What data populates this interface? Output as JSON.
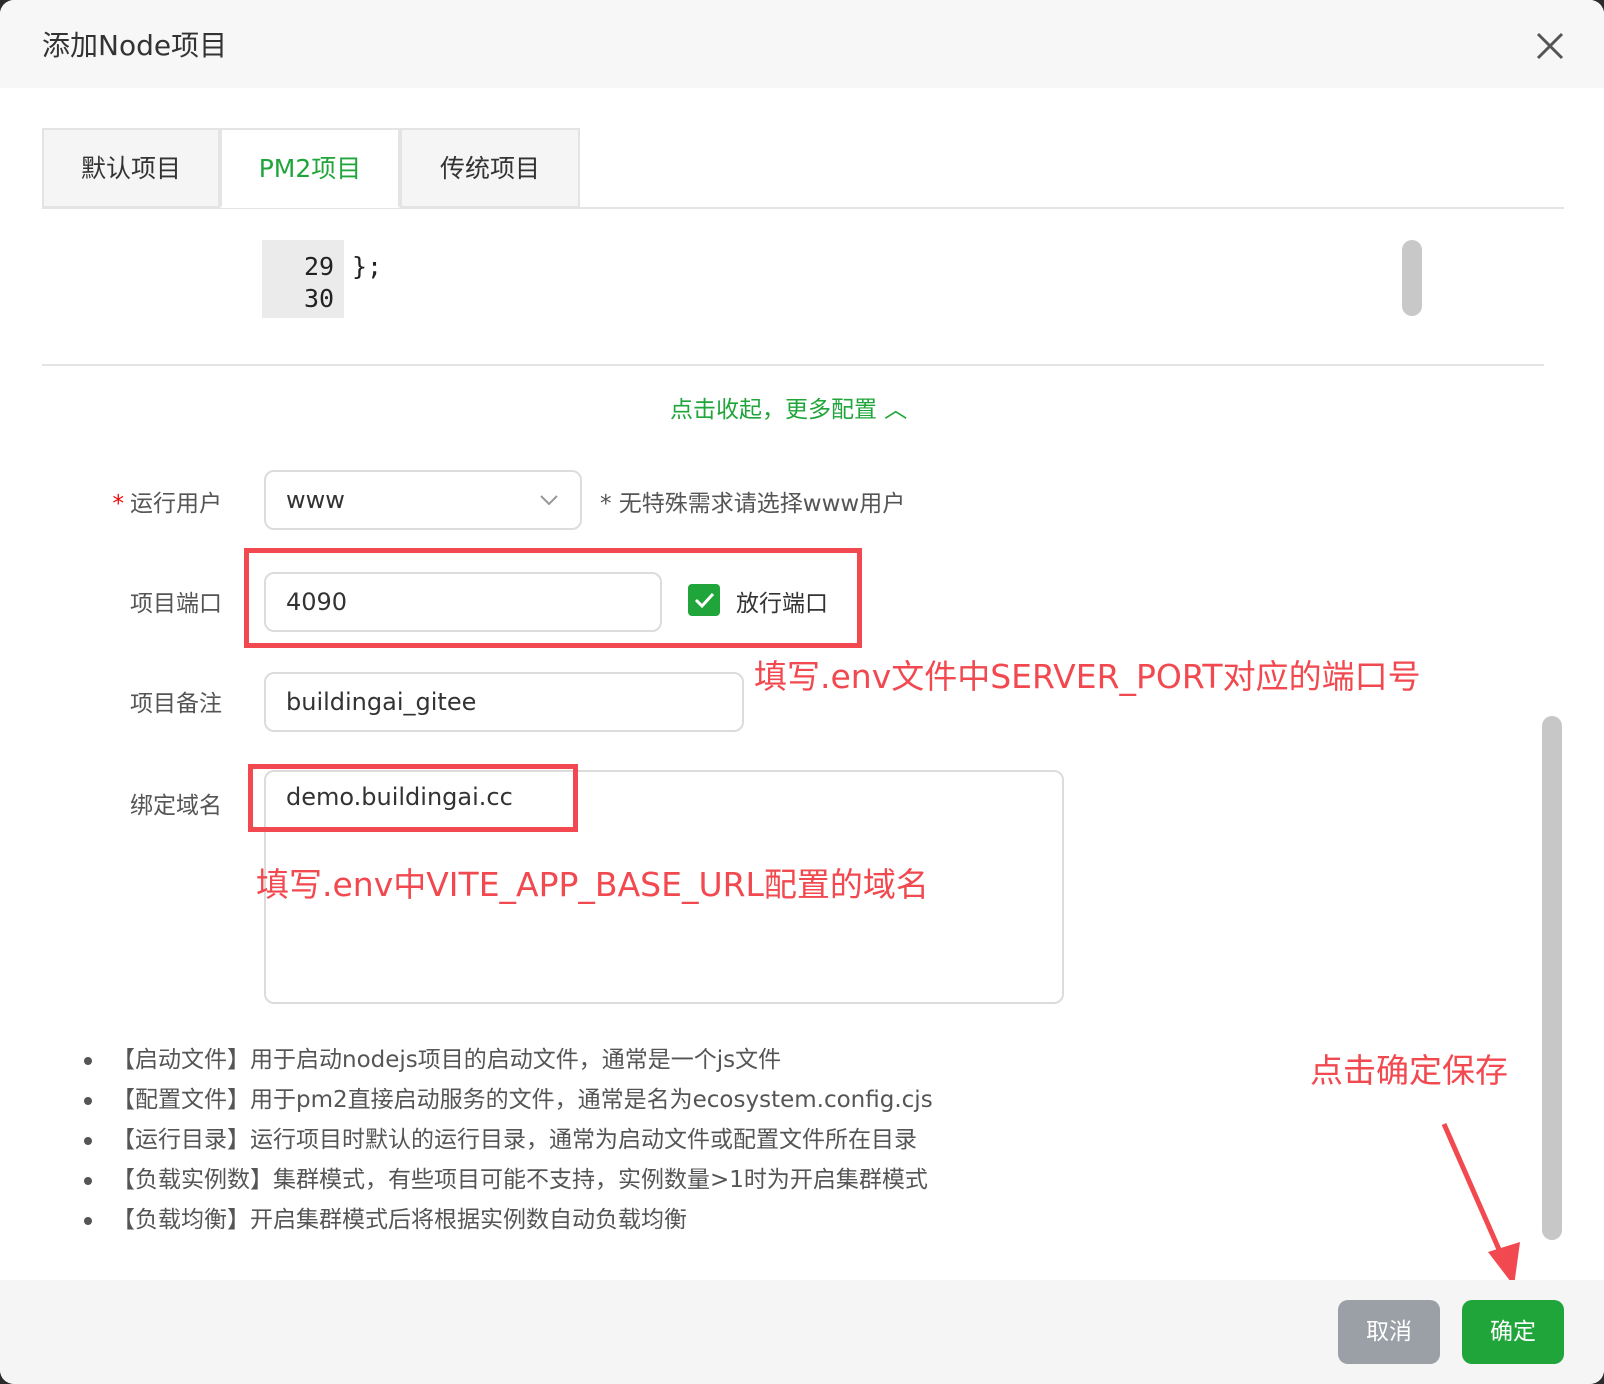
{
  "dialog": {
    "title": "添加Node项目"
  },
  "tabs": [
    {
      "label": "默认项目",
      "active": false
    },
    {
      "label": "PM2项目",
      "active": true
    },
    {
      "label": "传统项目",
      "active": false
    }
  ],
  "code": {
    "lines": [
      {
        "num": "29",
        "text": "};"
      },
      {
        "num": "30",
        "text": ""
      }
    ]
  },
  "collapse_link": "点击收起，更多配置 ︿",
  "form": {
    "run_user": {
      "label": "运行用户",
      "required_mark": "*",
      "value": "www",
      "hint": "* 无特殊需求请选择www用户"
    },
    "port": {
      "label": "项目端口",
      "value": "4090",
      "checkbox_label": "放行端口",
      "checked": true
    },
    "remark": {
      "label": "项目备注",
      "value": "buildingai_gitee"
    },
    "domain": {
      "label": "绑定域名",
      "value": "demo.buildingai.cc"
    }
  },
  "annotations": {
    "port_note": "填写.env文件中SERVER_PORT对应的端口号",
    "domain_note": "填写.env中VITE_APP_BASE_URL配置的域名",
    "confirm_note": "点击确定保存"
  },
  "tips": [
    "【启动文件】用于启动nodejs项目的启动文件，通常是一个js文件",
    "【配置文件】用于pm2直接启动服务的文件，通常是名为ecosystem.config.cjs",
    "【运行目录】运行项目时默认的运行目录，通常为启动文件或配置文件所在目录",
    "【负载实例数】集群模式，有些项目可能不支持，实例数量>1时为开启集群模式",
    "【负载均衡】开启集群模式后将根据实例数自动负载均衡"
  ],
  "buttons": {
    "cancel": "取消",
    "confirm": "确定"
  },
  "colors": {
    "accent": "#20a53a",
    "annotation": "#f1494f"
  },
  "icons": {
    "close": "close-icon",
    "select": "chevron-down-icon",
    "check": "check-icon",
    "collapse": "chevron-up-icon"
  }
}
